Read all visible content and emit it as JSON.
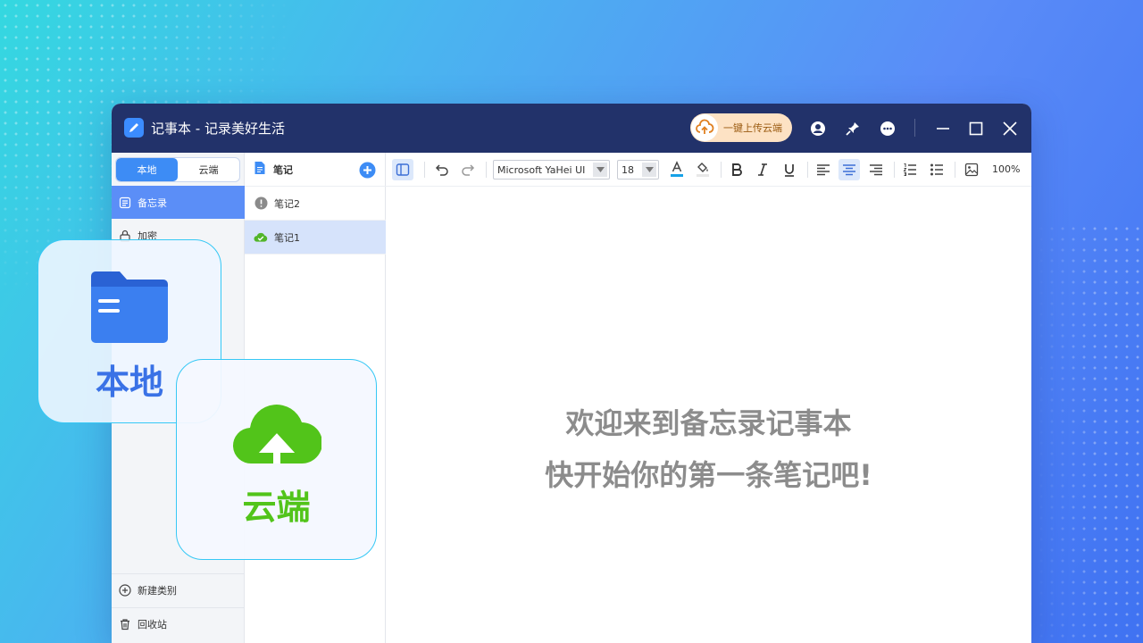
{
  "window": {
    "title": "记事本 - 记录美好生活"
  },
  "titlebar": {
    "upload_label": "一键上传云端"
  },
  "sidebar": {
    "tabs": [
      {
        "label": "本地"
      },
      {
        "label": "云端"
      }
    ],
    "categories": [
      {
        "label": "备忘录"
      },
      {
        "label": "加密"
      }
    ],
    "new_category_label": "新建类别",
    "recycle_label": "回收站"
  },
  "note_list": {
    "header": "笔记",
    "items": [
      {
        "label": "笔记2"
      },
      {
        "label": "笔记1"
      }
    ]
  },
  "editor": {
    "font_family": "Microsoft YaHei UI",
    "font_size": "18",
    "zoom": "100%",
    "welcome_line1": "欢迎来到备忘录记事本",
    "welcome_line2": "快开始你的第一条笔记吧!"
  },
  "overlay_cards": {
    "local_label": "本地",
    "cloud_label": "云端"
  },
  "colors": {
    "titlebar": "#22326a",
    "accent": "#3d8cf5",
    "cloud_green": "#52c41a",
    "folder_blue": "#3b7ff0",
    "welcome_text": "#8c8c8c"
  },
  "icons": {
    "app": "pen-note-icon",
    "upload": "cloud-upload-icon",
    "user": "user-icon",
    "pin": "pin-icon",
    "more": "more-icon",
    "minimize": "minimize-icon",
    "maximize": "maximize-icon",
    "close": "close-icon"
  }
}
